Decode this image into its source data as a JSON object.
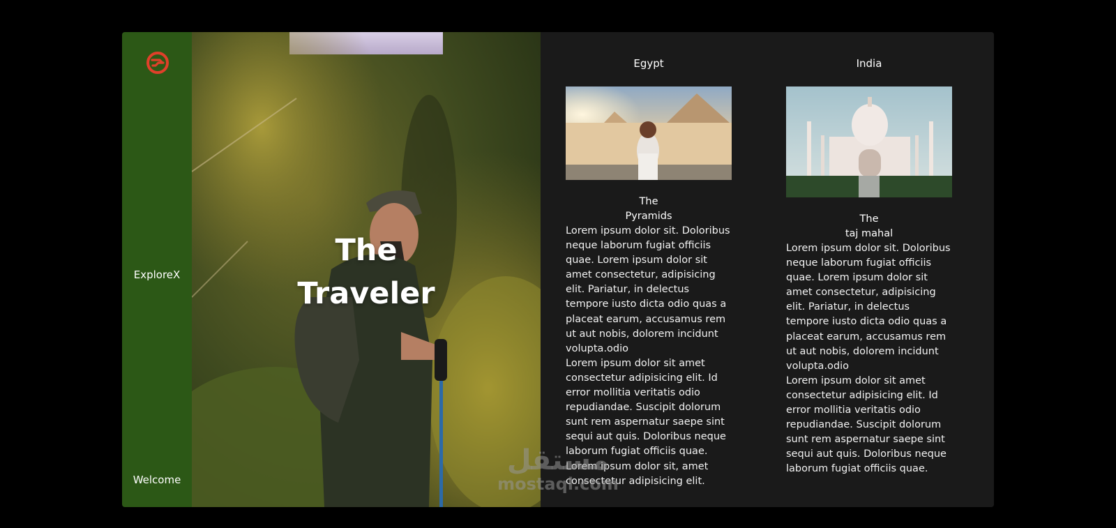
{
  "sidebar": {
    "brand": "ExploreX",
    "welcome": "Welcome",
    "logo_color": "#e0402a",
    "bg_color": "#2c5816"
  },
  "hero": {
    "title_line1": "The",
    "title_line2": "Traveler"
  },
  "destinations": [
    {
      "country": "Egypt",
      "place_line1": "The",
      "place_line2": "Pyramids",
      "paragraphs": [
        "Lorem ipsum dolor sit. Doloribus neque laborum fugiat officiis quae. Lorem ipsum dolor sit amet consectetur, adipisicing elit. Pariatur, in delectus tempore iusto dicta odio quas a placeat earum, accusamus rem ut aut nobis, dolorem incidunt volupta.odio",
        "Lorem ipsum dolor sit amet consectetur adipisicing elit. Id error mollitia veritatis odio repudiandae. Suscipit dolorum sunt rem aspernatur saepe sint sequi aut quis. Doloribus neque laborum fugiat officiis quae.",
        "Lorem ipsum dolor sit, amet consectetur adipisicing elit."
      ]
    },
    {
      "country": "India",
      "place_line1": "The",
      "place_line2": "taj mahal",
      "paragraphs": [
        "Lorem ipsum dolor sit. Doloribus neque laborum fugiat officiis quae. Lorem ipsum dolor sit amet consectetur, adipisicing elit. Pariatur, in delectus tempore iusto dicta odio quas a placeat earum, accusamus rem ut aut nobis, dolorem incidunt volupta.odio",
        "Lorem ipsum dolor sit amet consectetur adipisicing elit. Id error mollitia veritatis odio repudiandae. Suscipit dolorum sunt rem aspernatur saepe sint sequi aut quis. Doloribus neque laborum fugiat officiis quae."
      ]
    }
  ],
  "watermark": {
    "arabic": "مستقل",
    "latin": "mostaql.com"
  }
}
